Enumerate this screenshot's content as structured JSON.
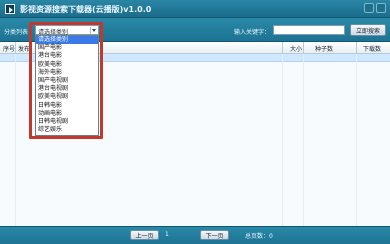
{
  "window": {
    "title": "影视资源搜索下载器(云播版)v1.0.0"
  },
  "toolbar": {
    "category_label": "分类列表：",
    "category_selected": "请选择类别",
    "keyword_label": "输入关键字：",
    "keyword_value": "",
    "search_button": "立即搜索"
  },
  "dropdown": {
    "options": [
      "请选择类别",
      "国产电影",
      "港台电影",
      "欧美电影",
      "海外电影",
      "国产电视剧",
      "港台电视剧",
      "欧美电视剧",
      "日韩电影",
      "动画电影",
      "日韩电视剧",
      "综艺娱乐"
    ],
    "selected_index": 0
  },
  "table": {
    "columns": [
      "序号",
      "发布",
      "大小",
      "种子数",
      "下载数"
    ]
  },
  "footer": {
    "prev_button": "上一页",
    "page": "1",
    "next_button": "下一页",
    "total_label": "总页数：0"
  },
  "colors": {
    "chrome": "#1f6f8d",
    "selection": "#3b79e6",
    "highlight_box": "#c0392b"
  }
}
